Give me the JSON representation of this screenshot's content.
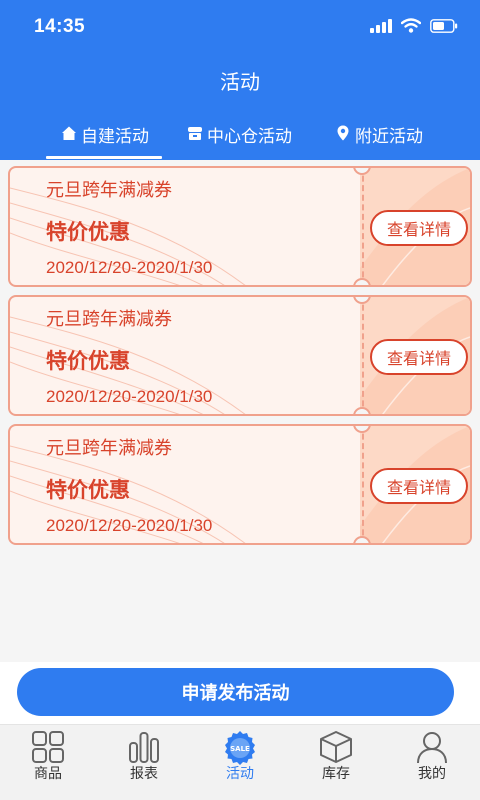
{
  "status_bar": {
    "time": "14:35"
  },
  "header": {
    "title": "活动"
  },
  "tabs": [
    {
      "label": "自建活动",
      "icon": "home-icon",
      "active": true
    },
    {
      "label": "中心仓活动",
      "icon": "store-icon",
      "active": false
    },
    {
      "label": "附近活动",
      "icon": "location-pin-icon",
      "active": false
    }
  ],
  "coupons": [
    {
      "name": "元旦跨年满减券",
      "label": "特价优惠",
      "date": "2020/12/20-2020/1/30",
      "button": "查看详情"
    },
    {
      "name": "元旦跨年满减券",
      "label": "特价优惠",
      "date": "2020/12/20-2020/1/30",
      "button": "查看详情"
    },
    {
      "name": "元旦跨年满减券",
      "label": "特价优惠",
      "date": "2020/12/20-2020/1/30",
      "button": "查看详情"
    }
  ],
  "publish_button": "申请发布活动",
  "bottom_nav": [
    {
      "label": "商品",
      "icon": "grid-icon",
      "active": false
    },
    {
      "label": "报表",
      "icon": "bar-chart-icon",
      "active": false
    },
    {
      "label": "活动",
      "icon": "sale-badge-icon",
      "active": true,
      "badge_text": "SALE"
    },
    {
      "label": "库存",
      "icon": "box-icon",
      "active": false
    },
    {
      "label": "我的",
      "icon": "user-icon",
      "active": false
    }
  ],
  "colors": {
    "primary": "#2f7cf0",
    "coupon_red": "#d8432b",
    "coupon_border": "#f0a18c",
    "coupon_bg": "#fef3ee"
  }
}
